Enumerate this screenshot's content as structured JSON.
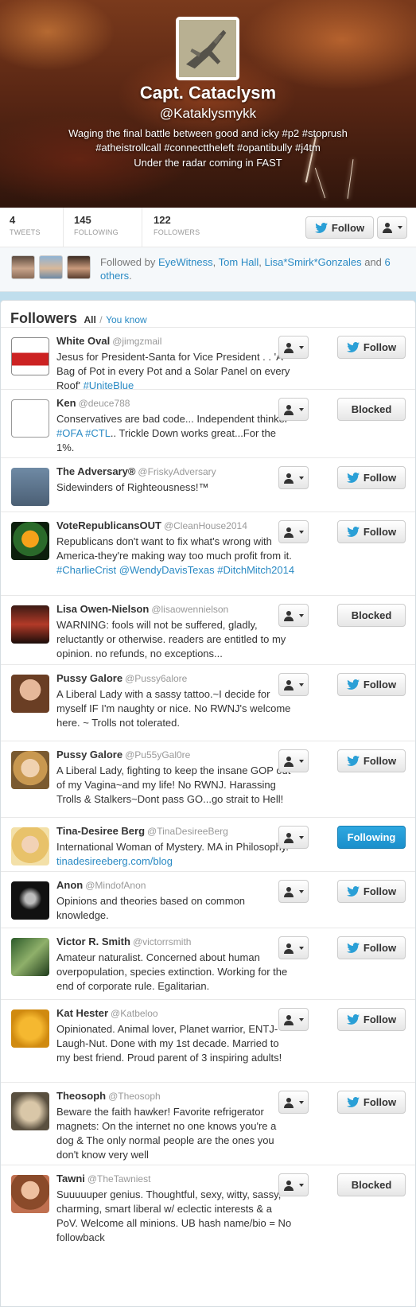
{
  "profile": {
    "name": "Capt. Cataclysm",
    "handle": "@Kataklysmykk",
    "bio_line1": "Waging the final battle between good and icky #p2 #stoprush",
    "bio_line2": "#atheistrollcall #connecttheleft #opantibully #j4tm",
    "location": "Under the radar coming in FAST"
  },
  "stats": [
    {
      "value": "4",
      "label": "TWEETS"
    },
    {
      "value": "145",
      "label": "FOLLOWING"
    },
    {
      "value": "122",
      "label": "FOLLOWERS"
    }
  ],
  "profile_actions": {
    "follow_label": "Follow"
  },
  "followed_by": {
    "prefix": "Followed by",
    "names": [
      "EyeWitness",
      "Tom Hall",
      "Lisa*Smirk*Gonzales"
    ],
    "sep1": ",",
    "sep2": ",",
    "and": "and",
    "others": "6 others",
    "end": "."
  },
  "followers_panel": {
    "title": "Followers",
    "all": "All",
    "slash": "/",
    "you_know": "You know"
  },
  "followers": [
    {
      "name": "White Oval",
      "handle": "@jimgzmail",
      "bio": "Jesus for President-Santa for Vice President . . 'A Bag of Pot in every Pot and a Solar Panel on every Roof'",
      "tag": "#UniteBlue",
      "action": "Follow",
      "state": "follow",
      "avatar": "jesus"
    },
    {
      "name": "Ken",
      "handle": "@deuce788",
      "bio": "Conservatives are bad code... Independent thinker",
      "tag": "#OFA #CTL",
      "bio2": ".. Trickle Down works great...For the 1%.",
      "action": "Blocked",
      "state": "blocked",
      "avatar": "radical"
    },
    {
      "name": "The Adversary®",
      "handle": "@FriskyAdversary",
      "bio": "Sidewinders of Righteousness!™",
      "action": "Follow",
      "state": "follow",
      "avatar": "jet"
    },
    {
      "name": "VoteRepublicansOUT",
      "handle": "@CleanHouse2014",
      "bio": "Republicans don't want to fix what's wrong with America-they're making way too much profit from it.",
      "tag": "#CharlieCrist @WendyDavisTexas #DitchMitch2014",
      "action": "Follow",
      "state": "follow",
      "avatar": "flower"
    },
    {
      "name": "Lisa Owen-Nielson",
      "handle": "@lisaowennielson",
      "bio": "WARNING: fools will not be suffered, gladly, reluctantly or otherwise. readers are entitled to my opinion. no refunds, no exceptions...",
      "action": "Blocked",
      "state": "blocked",
      "avatar": "zeppelin"
    },
    {
      "name": "Pussy Galore",
      "handle": "@Pussy6alore",
      "bio": "A Liberal Lady with a sassy tattoo.~I decide for myself IF I'm naughty or nice. No RWNJ's welcome here. ~ Trolls not tolerated.",
      "action": "Follow",
      "state": "follow",
      "avatar": "woman1"
    },
    {
      "name": "Pussy Galore",
      "handle": "@Pu55yGal0re",
      "bio": "A Liberal Lady, fighting to keep the insane GOP out of my Vagina~and my life! No RWNJ. Harassing Trolls & Stalkers~Dont pass GO...go strait to Hell!",
      "action": "Follow",
      "state": "follow",
      "avatar": "woman2"
    },
    {
      "name": "Tina-Desiree Berg",
      "handle": "@TinaDesireeBerg",
      "bio": "International Woman of Mystery. MA in Philosophy.",
      "tag": "tinadesireeberg.com/blog",
      "action": "Following",
      "state": "following",
      "avatar": "blonde"
    },
    {
      "name": "Anon",
      "handle": "@MindofAnon",
      "bio": "Opinions and theories based on common knowledge.",
      "action": "Follow",
      "state": "follow",
      "avatar": "anon"
    },
    {
      "name": "Victor R. Smith",
      "handle": "@victorrsmith",
      "bio": "Amateur naturalist. Concerned about human overpopulation, species extinction. Working for the end of corporate rule. Egalitarian.",
      "action": "Follow",
      "state": "follow",
      "avatar": "nature"
    },
    {
      "name": "Kat Hester",
      "handle": "@Katbeloo",
      "bio": "Opinionated. Animal lover, Planet warrior, ENTJ-Laugh-Nut. Done with my 1st decade. Married to my best friend. Proud parent of 3 inspiring adults!",
      "action": "Follow",
      "state": "follow",
      "avatar": "kat"
    },
    {
      "name": "Theosoph",
      "handle": "@Theosoph",
      "bio": "Beware the faith hawker! Favorite refrigerator magnets: On the internet no one knows you're a dog & The only normal people are the ones you don't know very well",
      "action": "Follow",
      "state": "follow",
      "avatar": "dog"
    },
    {
      "name": "Tawni",
      "handle": "@TheTawniest",
      "bio": "Suuuuuper genius. Thoughtful, sexy, witty, sassy, charming, smart liberal w/ eclectic interests & a PoV. Welcome all minions. UB hash name/bio = No followback",
      "action": "Blocked",
      "state": "blocked",
      "avatar": "tawni"
    }
  ],
  "colors": {
    "link": "#2a8ac4",
    "following_bg": "#1a8fcb",
    "page_bg": "#c0deed"
  }
}
